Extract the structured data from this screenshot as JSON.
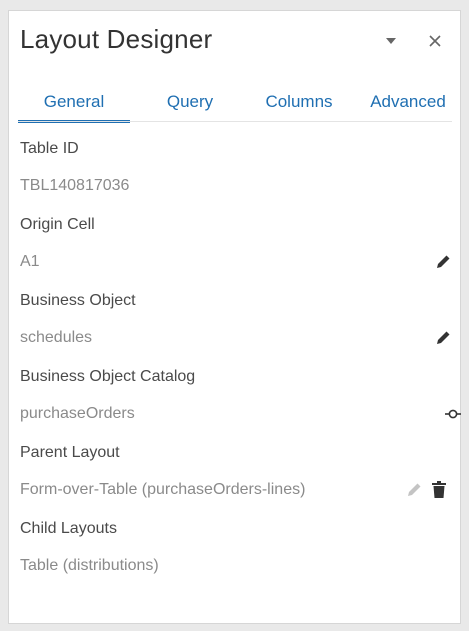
{
  "header": {
    "title": "Layout Designer",
    "dropdown_icon": "caret-down-icon",
    "close_icon": "close-icon"
  },
  "tabs": [
    {
      "label": "General",
      "active": true
    },
    {
      "label": "Query",
      "active": false
    },
    {
      "label": "Columns",
      "active": false
    },
    {
      "label": "Advanced",
      "active": false
    }
  ],
  "fields": {
    "table_id": {
      "label": "Table ID",
      "value": "TBL140817036"
    },
    "origin_cell": {
      "label": "Origin Cell",
      "value": "A1",
      "icon": "pencil-icon"
    },
    "business_object": {
      "label": "Business Object",
      "value": "schedules",
      "icon": "pencil-icon"
    },
    "business_object_catalog": {
      "label": "Business Object Catalog",
      "value": "purchaseOrders",
      "icon": "commit-node-icon"
    },
    "parent_layout": {
      "label": "Parent Layout",
      "value": "Form-over-Table (purchaseOrders-lines)",
      "icons": [
        "pencil-icon",
        "trash-icon"
      ]
    },
    "child_layouts": {
      "label": "Child Layouts",
      "value": "Table (distributions)"
    }
  },
  "colors": {
    "accent": "#1f6fb2",
    "label_text": "#4a4a4a",
    "value_text": "#8a8a8a",
    "icon": "#333333",
    "icon_disabled": "#c4c4c4"
  }
}
